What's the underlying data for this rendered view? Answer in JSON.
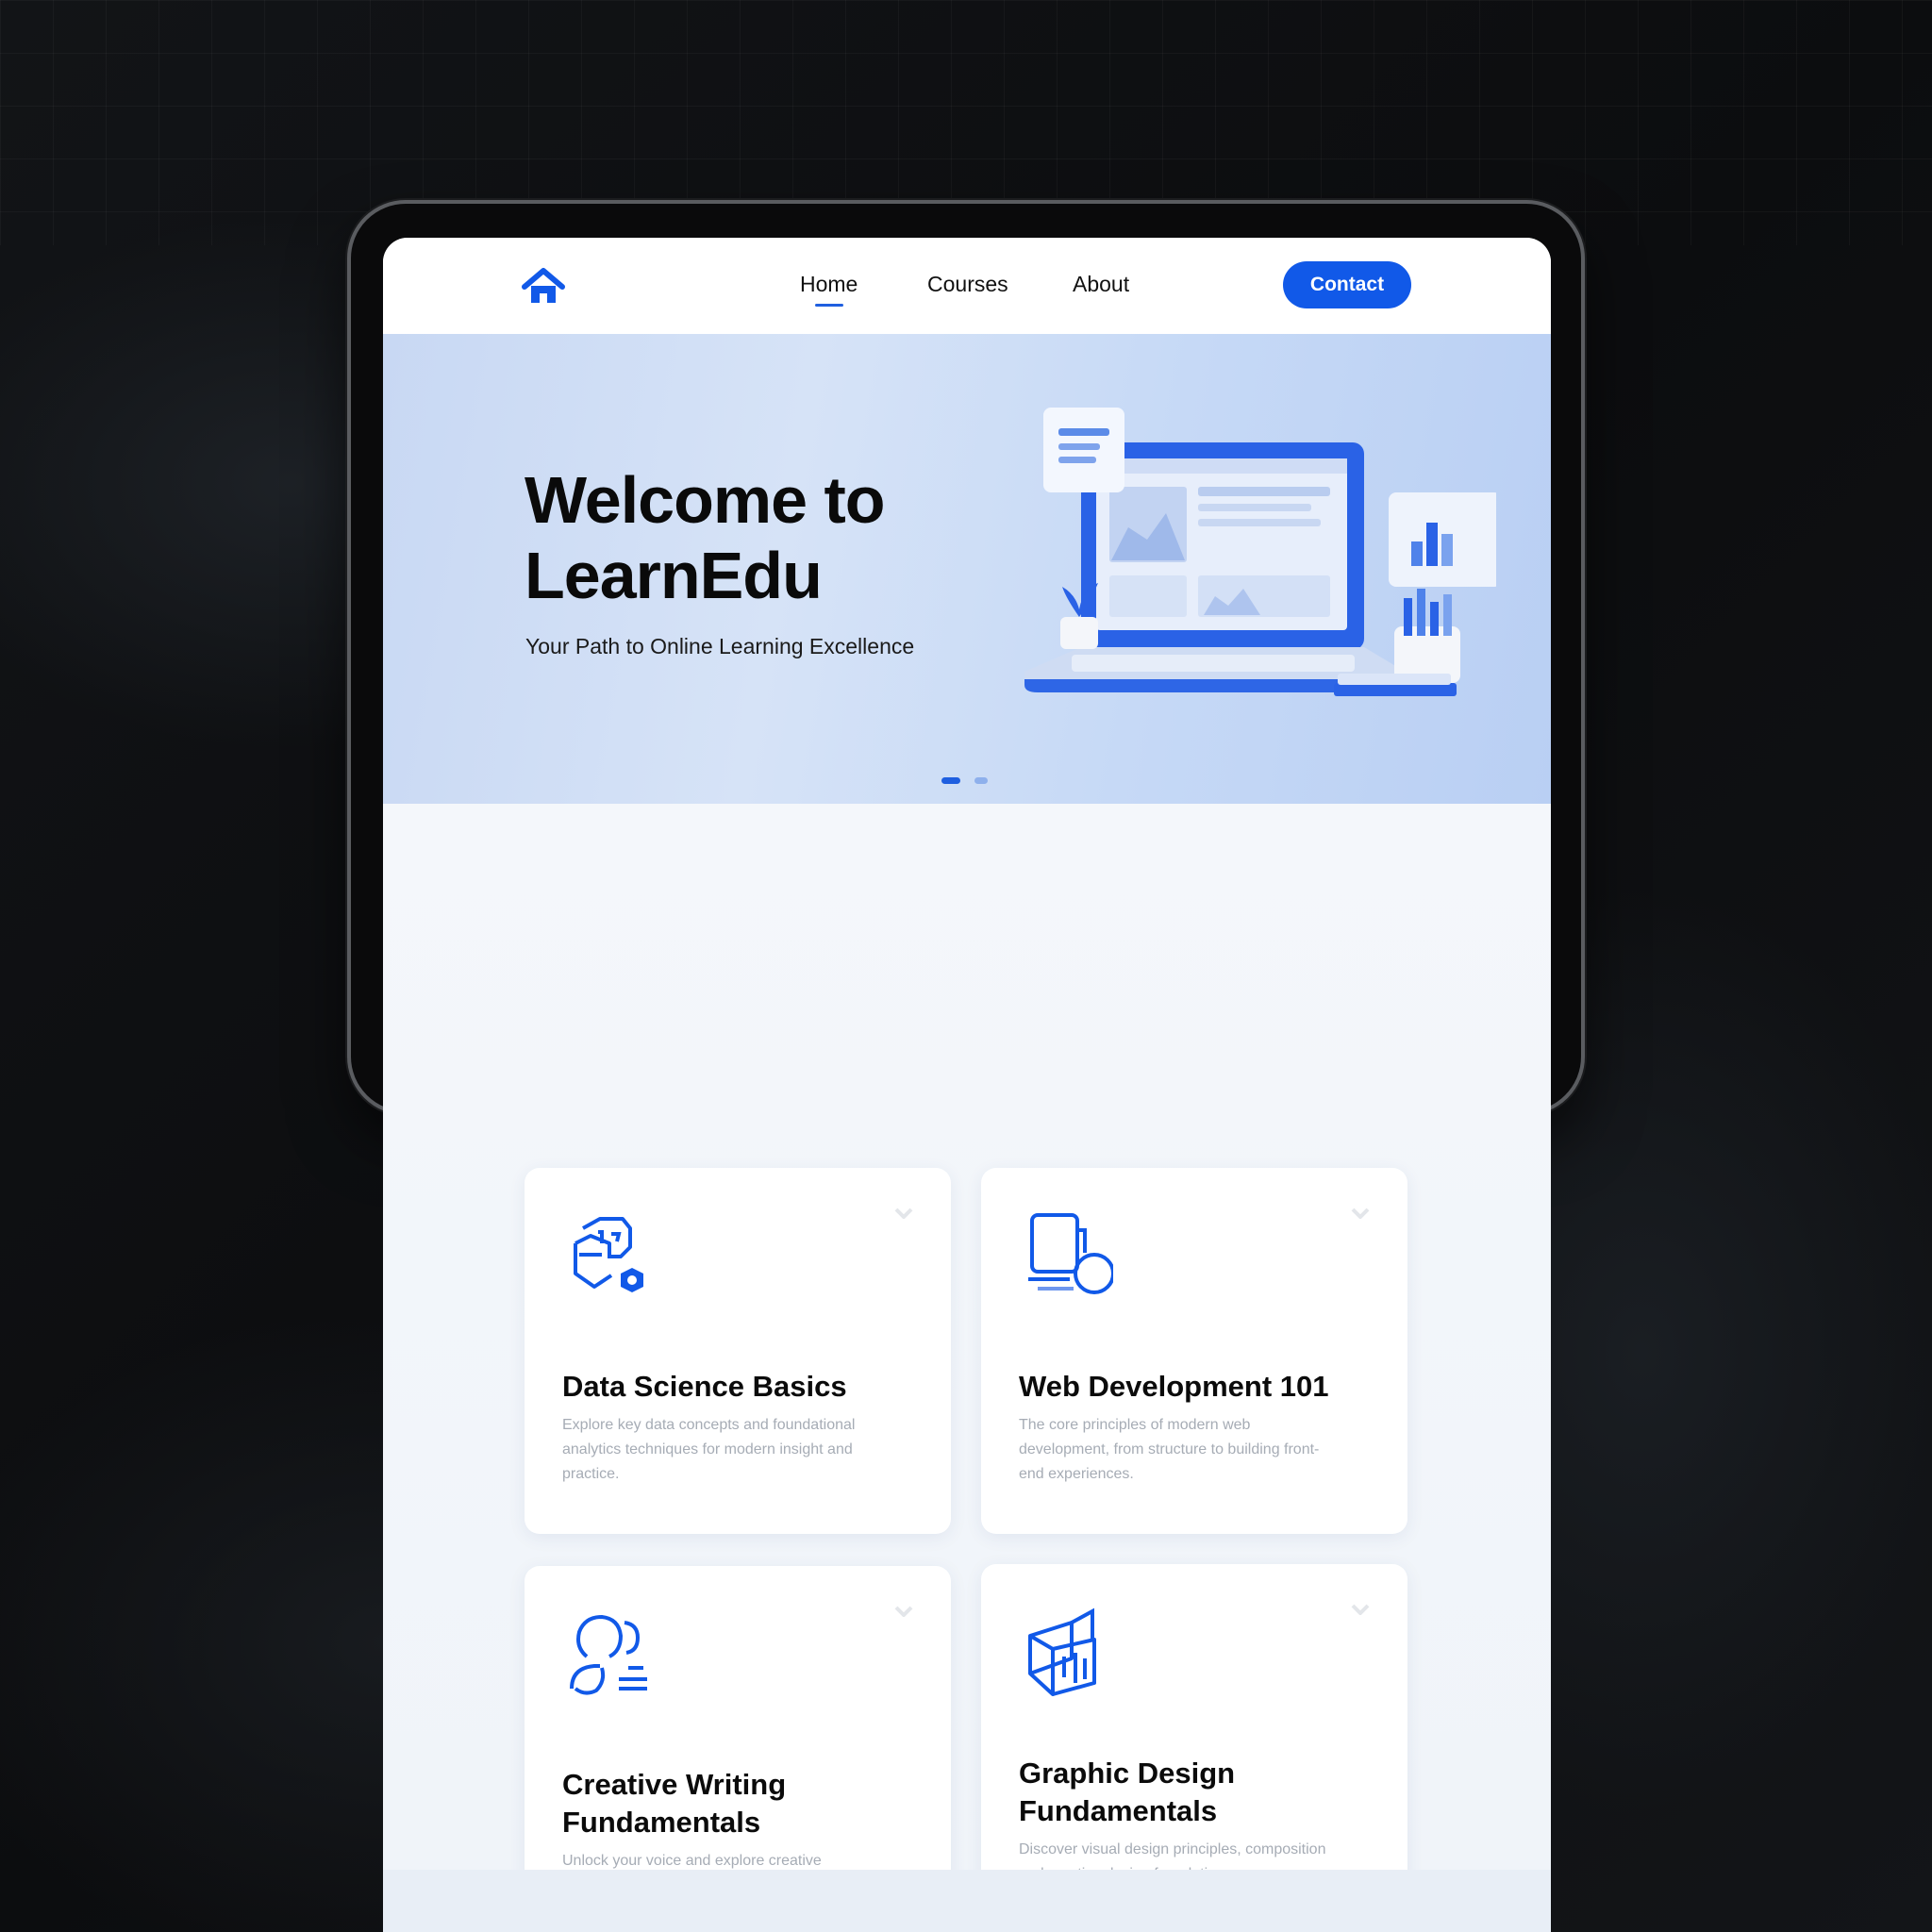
{
  "nav": {
    "logo_icon": "home-icon",
    "links": [
      {
        "label": "Home",
        "active": true
      },
      {
        "label": "Courses",
        "active": false
      },
      {
        "label": "About",
        "active": false
      }
    ],
    "contact_label": "Contact"
  },
  "hero": {
    "title": "Welcome to LearnEdu",
    "subtitle": "Your Path to Online Learning Excellence",
    "illustration_icon": "laptop-dashboard-icon",
    "carousel_dots": 2,
    "active_dot": 0
  },
  "courses": [
    {
      "title": "Data Science Basics",
      "icon": "data-science-icon",
      "description": "Explore key data concepts and foundational analytics techniques for modern insight and practice."
    },
    {
      "title": "Web Development 101",
      "icon": "devices-icon",
      "description": "The core principles of modern web development, from structure to building front-end experiences."
    },
    {
      "title": "Creative Writing Fundamentals",
      "icon": "people-writing-icon",
      "description": "Unlock your voice and explore creative storytelling, narrative craft and compositions."
    },
    {
      "title": "Graphic Design Fundamentals",
      "icon": "cube-design-icon",
      "description": "Discover visual design principles, composition and creative design foundations."
    }
  ],
  "colors": {
    "accent": "#1159e8",
    "hero_bg": "#cddcf5",
    "page_bg": "#f2f5f9",
    "device_bg": "#0a0a0b"
  }
}
